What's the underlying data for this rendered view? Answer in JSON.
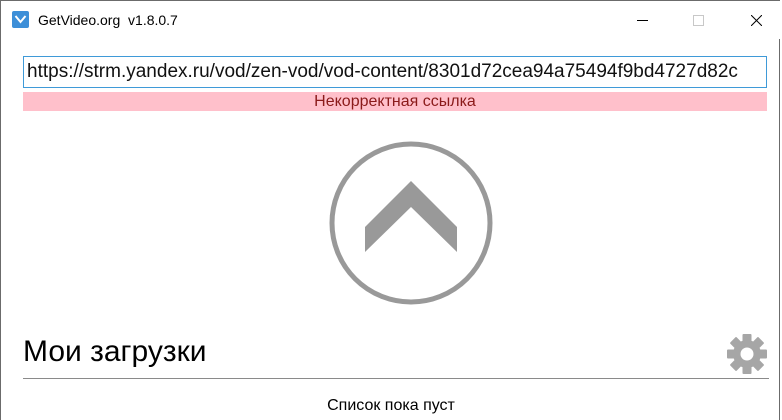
{
  "window": {
    "app_name": "GetVideo.org",
    "version": "v1.8.0.7"
  },
  "url_input": {
    "value": "https://strm.yandex.ru/vod/zen-vod/vod-content/8301d72cea94a75494f9bd4727d82c"
  },
  "error": {
    "message": "Некорректная ссылка",
    "background_color": "#ffc0cb",
    "text_color": "#8b1a1a"
  },
  "upload_button": {
    "icon": "chevron-up-icon",
    "color": "#999999"
  },
  "downloads": {
    "title": "Мои загрузки",
    "empty_message": "Список пока пуст",
    "settings_icon": "gear-icon"
  }
}
